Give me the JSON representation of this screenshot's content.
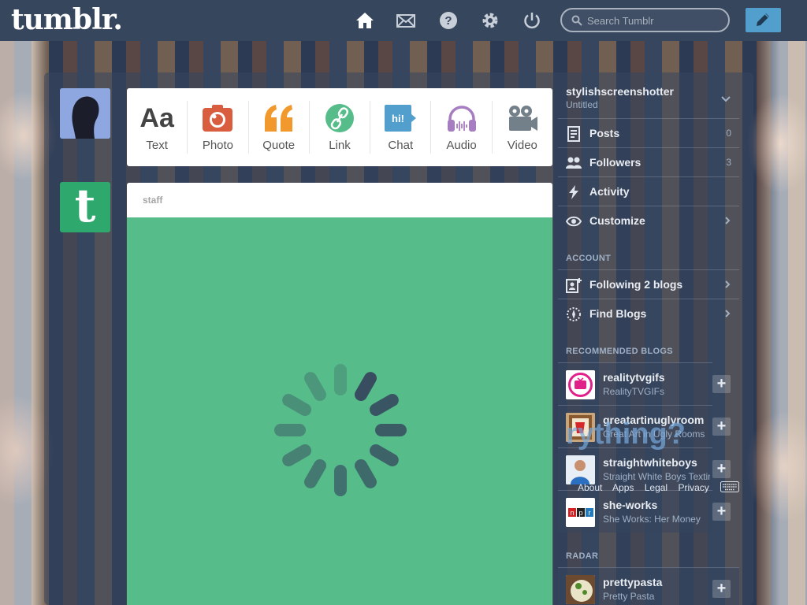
{
  "header": {
    "logo": "tumblr.",
    "search_placeholder": "Search Tumblr",
    "icons": [
      "home-icon",
      "mail-icon",
      "help-icon",
      "gear-icon",
      "power-icon",
      "pencil-icon"
    ]
  },
  "post_types": [
    {
      "label": "Text",
      "icon": "text-icon",
      "color": "#444444"
    },
    {
      "label": "Photo",
      "icon": "camera-icon",
      "color": "#d95e40"
    },
    {
      "label": "Quote",
      "icon": "quote-icon",
      "color": "#f2992e"
    },
    {
      "label": "Link",
      "icon": "link-icon",
      "color": "#56bc8a"
    },
    {
      "label": "Chat",
      "icon": "chat-icon",
      "color": "#529ecc"
    },
    {
      "label": "Audio",
      "icon": "headphones-icon",
      "color": "#a77dc2"
    },
    {
      "label": "Video",
      "icon": "video-camera-icon",
      "color": "#748089"
    }
  ],
  "post": {
    "author": "staff",
    "background": "#56bc8a"
  },
  "sidebar": {
    "blog_name": "stylishscreenshotter",
    "blog_subtitle": "Untitled",
    "rows": [
      {
        "label": "Posts",
        "count": "0",
        "icon": "posts-icon"
      },
      {
        "label": "Followers",
        "count": "3",
        "icon": "followers-icon"
      },
      {
        "label": "Activity",
        "count": "",
        "icon": "lightning-icon"
      },
      {
        "label": "Customize",
        "count": "",
        "icon": "eye-icon"
      }
    ],
    "account_heading": "ACCOUNT",
    "account_rows": [
      {
        "label": "Following 2 blogs",
        "icon": "following-icon"
      },
      {
        "label": "Find Blogs",
        "icon": "compass-icon"
      }
    ],
    "recommended_heading": "RECOMMENDED BLOGS",
    "recommended": [
      {
        "name": "realitytvgifs",
        "title": "RealityTVGIFs"
      },
      {
        "name": "greatartinuglyroom",
        "title": "Great Art in Ugly Rooms"
      },
      {
        "name": "straightwhiteboys",
        "title": "Straight White Boys Texting"
      },
      {
        "name": "she-works",
        "title": "She Works: Her Money"
      }
    ],
    "footer_links": [
      "About",
      "Apps",
      "Legal",
      "Privacy"
    ],
    "overlay_text": "rything?",
    "radar_heading": "RADAR",
    "radar": {
      "name": "prettypasta",
      "title": "Pretty Pasta"
    }
  }
}
